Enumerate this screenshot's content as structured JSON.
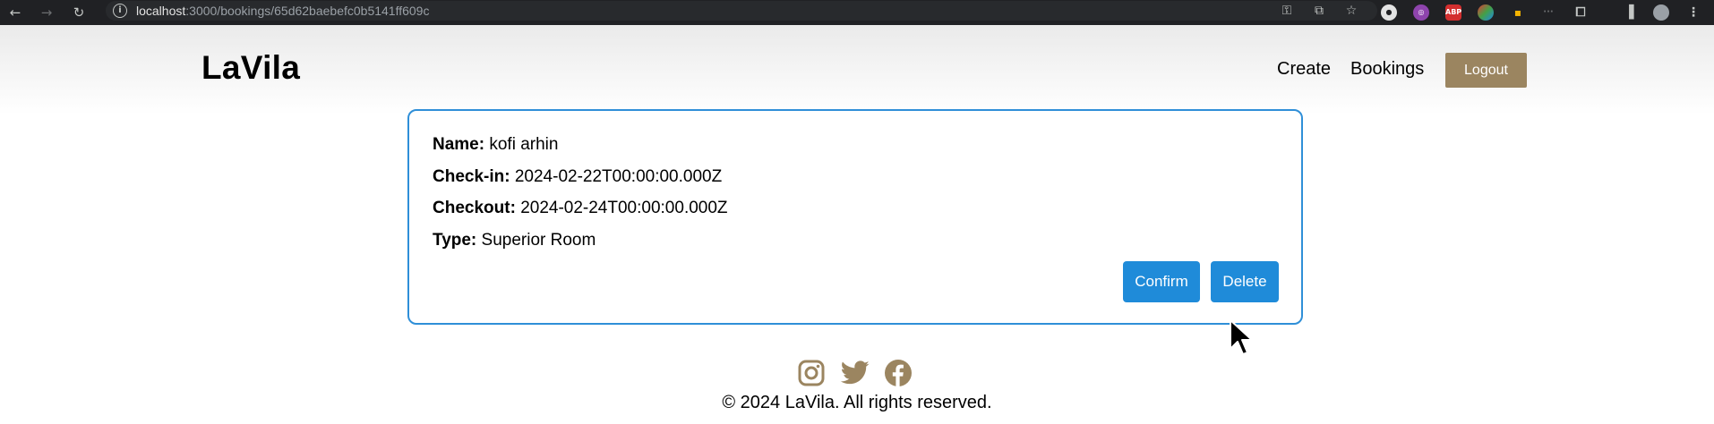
{
  "browser": {
    "url_host": "localhost",
    "url_path": ":3000/bookings/65d62baebefc0b5141ff609c"
  },
  "header": {
    "logo": "LaVila",
    "nav": [
      {
        "label": "Create"
      },
      {
        "label": "Bookings"
      }
    ],
    "logout_label": "Logout"
  },
  "booking": {
    "name_label": "Name:",
    "name_value": "kofi arhin",
    "checkin_label": "Check-in:",
    "checkin_value": "2024-02-22T00:00:00.000Z",
    "checkout_label": "Checkout:",
    "checkout_value": "2024-02-24T00:00:00.000Z",
    "type_label": "Type:",
    "type_value": "Superior Room",
    "confirm_label": "Confirm",
    "delete_label": "Delete"
  },
  "footer": {
    "social_icons": [
      "instagram-icon",
      "twitter-icon",
      "facebook-icon"
    ],
    "copyright": "© 2024 LaVila. All rights reserved."
  },
  "colors": {
    "accent_blue": "#1f8bd9",
    "logout_gold": "#9b8560",
    "social_gold": "#9b8560"
  }
}
